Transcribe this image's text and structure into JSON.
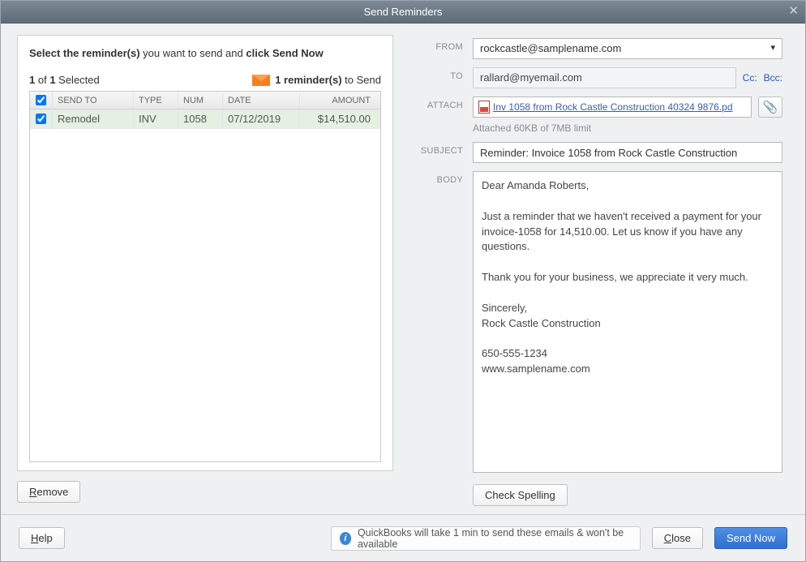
{
  "window": {
    "title": "Send Reminders"
  },
  "left": {
    "instruction_bold1": "Select the reminder(s)",
    "instruction_mid": " you want to send and ",
    "instruction_bold2": "click Send Now",
    "selected_bold1": "1",
    "selected_mid": " of ",
    "selected_bold2": "1",
    "selected_tail": " Selected",
    "reminders_bold": "1 reminder(s)",
    "reminders_tail": " to Send",
    "headers": {
      "send_to": "SEND TO",
      "type": "TYPE",
      "num": "NUM",
      "date": "DATE",
      "amount": "AMOUNT"
    },
    "rows": [
      {
        "send_to": "Remodel",
        "type": "INV",
        "num": "1058",
        "date": "07/12/2019",
        "amount": "$14,510.00"
      }
    ],
    "remove_label": "Remove",
    "remove_underline": "R"
  },
  "right": {
    "labels": {
      "from": "FROM",
      "to": "TO",
      "attach": "ATTACH",
      "subject": "SUBJECT",
      "body": "BODY"
    },
    "from_value": "rockcastle@samplename.com",
    "to_value": "rallard@myemail.com",
    "cc_label": "Cc:",
    "bcc_label": "Bcc:",
    "attach_filename": "Inv 1058 from Rock Castle Construction 40324 9876.pd",
    "attach_hint": "Attached 60KB of 7MB limit",
    "subject_value": "Reminder: Invoice 1058 from Rock Castle Construction",
    "body_text": "Dear Amanda Roberts,\n\nJust a reminder that we haven't received a payment for your\ninvoice-1058 for 14,510.00. Let us know if you have any questions.\n\nThank you for your business, we appreciate it very much.\n\nSincerely,\nRock Castle Construction\n\n650-555-1234\nwww.samplename.com",
    "check_spelling_label": "Check Spelling"
  },
  "footer": {
    "help_label": "Help",
    "help_underline": "H",
    "info_text": "QuickBooks will take 1 min to send these emails & won't be available",
    "close_label": "Close",
    "close_underline": "C",
    "send_label": "Send Now"
  }
}
